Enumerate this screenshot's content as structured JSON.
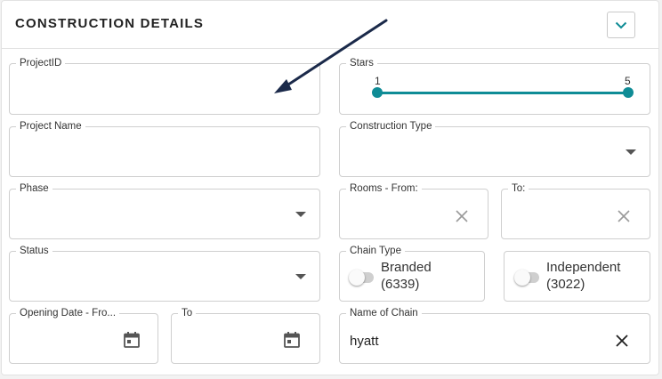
{
  "panel": {
    "title": "CONSTRUCTION DETAILS",
    "collapse_icon": "chevron-down-icon"
  },
  "fields": {
    "project_id": {
      "label": "ProjectID",
      "value": ""
    },
    "project_name": {
      "label": "Project Name",
      "value": ""
    },
    "phase": {
      "label": "Phase",
      "value": ""
    },
    "status": {
      "label": "Status",
      "value": ""
    },
    "opening_date_from": {
      "label": "Opening Date - Fro...",
      "value": ""
    },
    "opening_date_to": {
      "label": "To",
      "value": ""
    },
    "stars": {
      "label": "Stars",
      "min_label": "1",
      "max_label": "5",
      "min": 1,
      "max": 5
    },
    "construction_type": {
      "label": "Construction Type",
      "value": ""
    },
    "rooms_from": {
      "label": "Rooms - From:",
      "value": ""
    },
    "rooms_to": {
      "label": "To:",
      "value": ""
    },
    "chain_type": {
      "label": "Chain Type",
      "branded_line1": "Branded",
      "branded_line2": "(6339)",
      "independent_line1": "Independent",
      "independent_line2": "(3022)"
    },
    "name_of_chain": {
      "label": "Name of Chain",
      "value": "hyatt"
    }
  },
  "colors": {
    "accent": "#0f8c96",
    "arrow": "#1b2a4a"
  }
}
